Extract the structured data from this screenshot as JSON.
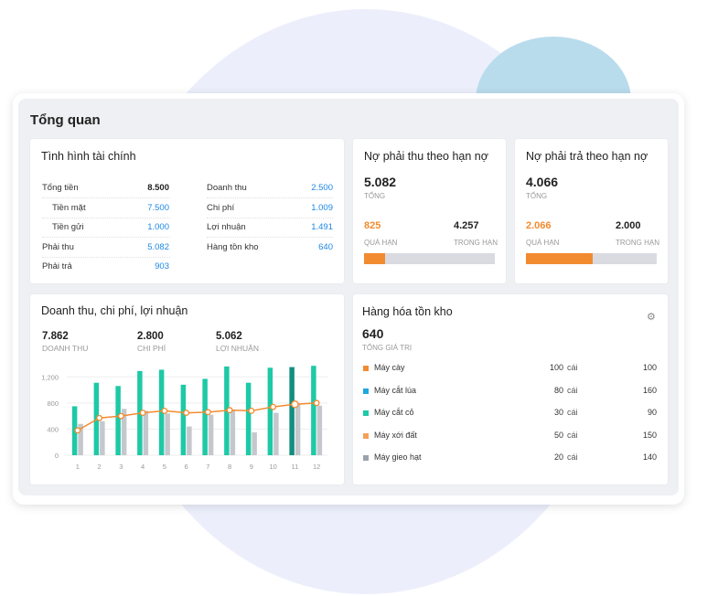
{
  "page": {
    "title": "Tổng quan"
  },
  "finance": {
    "title": "Tình hình tài chính",
    "left": [
      {
        "label": "Tổng tiền",
        "value": "8.500",
        "bold": true,
        "indent": false
      },
      {
        "label": "Tiền mặt",
        "value": "7.500",
        "bold": false,
        "indent": true
      },
      {
        "label": "Tiền gửi",
        "value": "1.000",
        "bold": false,
        "indent": true
      },
      {
        "label": "Phải thu",
        "value": "5.082",
        "bold": false,
        "indent": false
      },
      {
        "label": "Phải trả",
        "value": "903",
        "bold": false,
        "indent": false
      }
    ],
    "right": [
      {
        "label": "Doanh thu",
        "value": "2.500"
      },
      {
        "label": "Chi phí",
        "value": "1.009"
      },
      {
        "label": "Lợi nhuận",
        "value": "1.491"
      },
      {
        "label": "Hàng tồn kho",
        "value": "640"
      }
    ]
  },
  "receivable": {
    "title": "Nợ phải thu theo hạn nợ",
    "total": "5.082",
    "total_label": "TỔNG",
    "overdue": "825",
    "overdue_label": "QUÁ HẠN",
    "in_term": "4.257",
    "in_term_label": "TRONG HẠN",
    "overdue_fraction": 0.162
  },
  "payable": {
    "title": "Nợ phải trả theo hạn nợ",
    "total": "4.066",
    "total_label": "TỔNG",
    "overdue": "2.066",
    "overdue_label": "QUÁ HẠN",
    "in_term": "2.000",
    "in_term_label": "TRONG HẠN",
    "overdue_fraction": 0.508
  },
  "revenue": {
    "title": "Doanh thu, chi phí, lợi nhuận",
    "kpis": [
      {
        "value": "7.862",
        "label": "DOANH THU"
      },
      {
        "value": "2.800",
        "label": "CHI PHÍ"
      },
      {
        "value": "5.062",
        "label": "LỢI NHUẬN"
      }
    ]
  },
  "inventory": {
    "title": "Hàng hóa tồn kho",
    "total": "640",
    "total_label": "TỔNG GIÁ TRỊ",
    "gear_icon": "gear-icon",
    "items": [
      {
        "name": "Máy cày",
        "qty": "100",
        "unit": "cái",
        "value": "100",
        "color": "#f28b30"
      },
      {
        "name": "Máy cắt lúa",
        "qty": "80",
        "unit": "cái",
        "value": "160",
        "color": "#1ea7e0"
      },
      {
        "name": "Máy cắt cỏ",
        "qty": "30",
        "unit": "cái",
        "value": "90",
        "color": "#1ec9a6"
      },
      {
        "name": "Máy xới đất",
        "qty": "50",
        "unit": "cái",
        "value": "150",
        "color": "#f5a05a"
      },
      {
        "name": "Máy gieo hạt",
        "qty": "20",
        "unit": "cái",
        "value": "140",
        "color": "#9aa3ad"
      }
    ]
  },
  "chart_data": {
    "type": "bar",
    "categories": [
      "1",
      "2",
      "3",
      "4",
      "5",
      "6",
      "7",
      "8",
      "9",
      "10",
      "11",
      "12"
    ],
    "yticks": [
      "0",
      "400",
      "800",
      "1,200"
    ],
    "ylim": [
      0,
      1400
    ],
    "series": [
      {
        "kind": "bar",
        "color": "#1ec9a6",
        "highlight_color": "#138f80",
        "values": [
          750,
          1110,
          1060,
          1290,
          1310,
          1080,
          1170,
          1360,
          1110,
          1340,
          1350,
          1370
        ]
      },
      {
        "kind": "bar",
        "color": "#c4c8cd",
        "values": [
          480,
          520,
          710,
          680,
          640,
          440,
          620,
          700,
          350,
          650,
          790,
          760
        ]
      },
      {
        "kind": "line",
        "color": "#f28b30",
        "values": [
          380,
          570,
          600,
          650,
          680,
          650,
          660,
          690,
          680,
          740,
          780,
          800
        ]
      }
    ],
    "highlight_index": 10
  }
}
